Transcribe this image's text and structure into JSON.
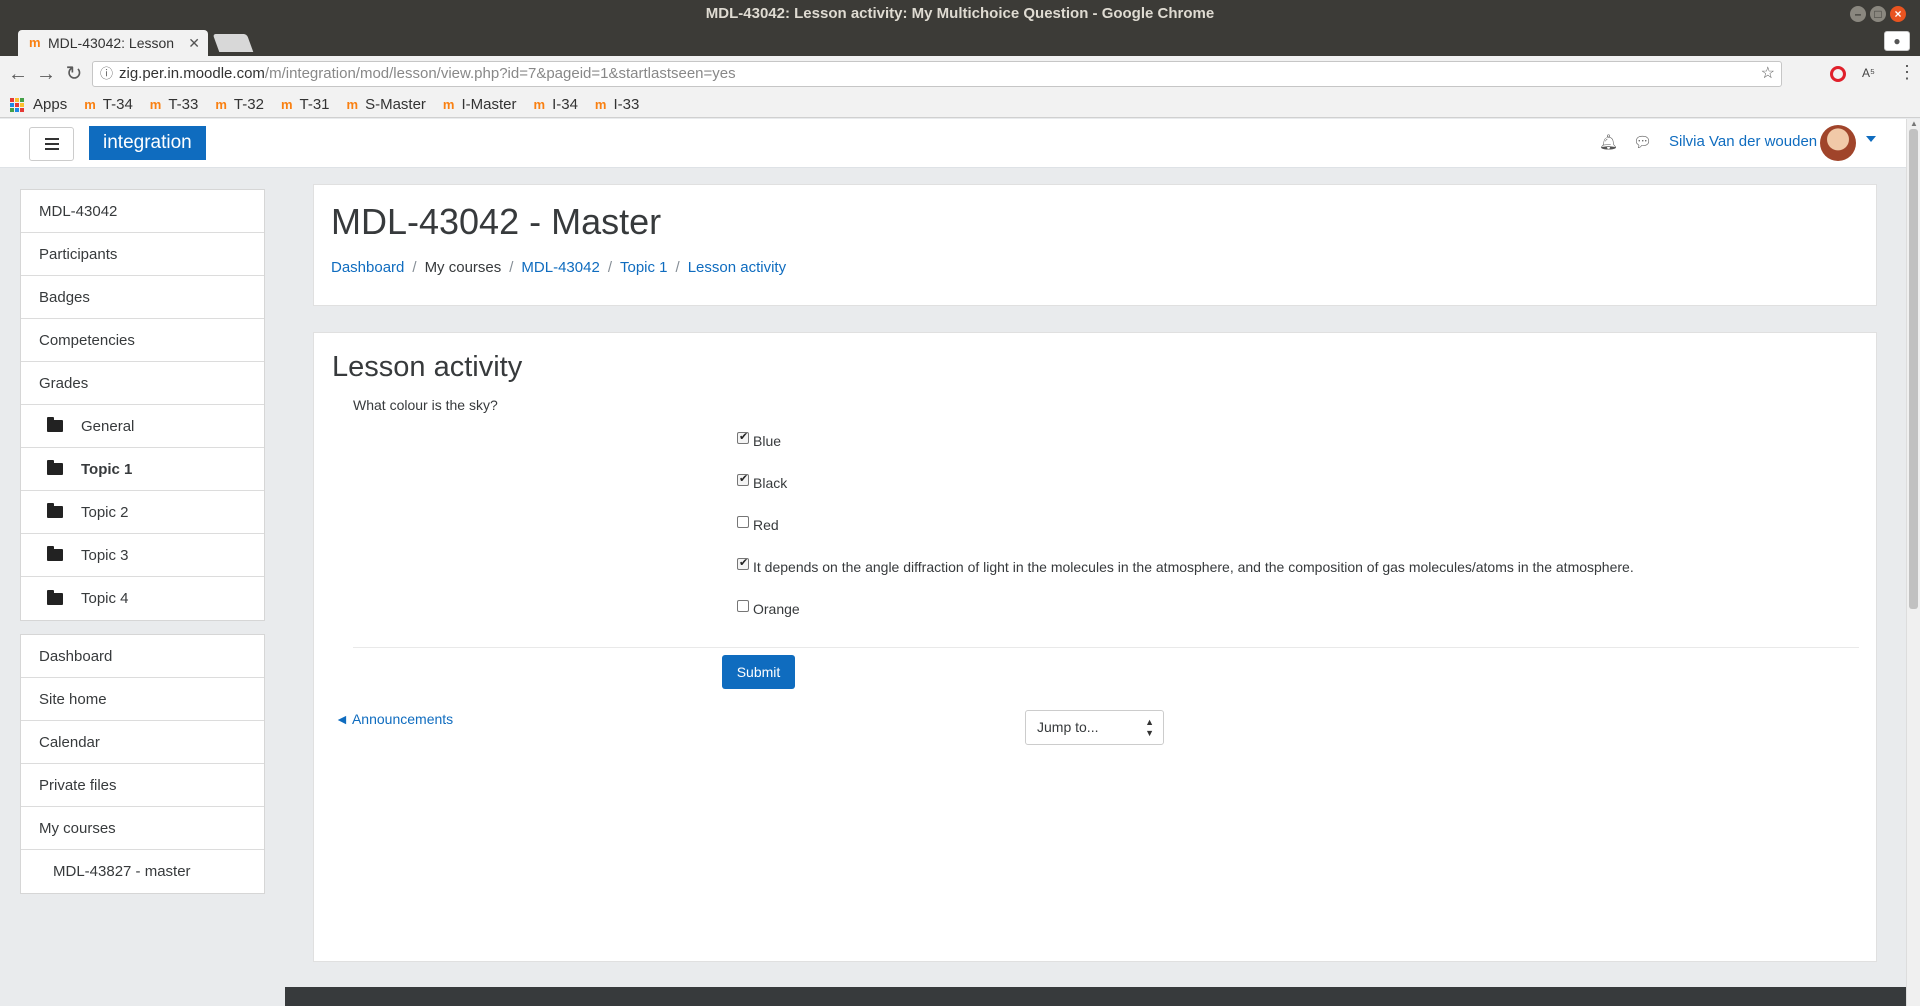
{
  "window": {
    "title": "MDL-43042: Lesson activity: My Multichoice Question - Google Chrome"
  },
  "tab": {
    "label": "MDL-43042: Lesson",
    "favicon": "m"
  },
  "address": {
    "host": "zig.per.in.moodle.com",
    "path": "/m/integration/mod/lesson/view.php?id=7&pageid=1&startlastseen=yes"
  },
  "bookmarks": {
    "apps_label": "Apps",
    "items": [
      "T-34",
      "T-33",
      "T-32",
      "T-31",
      "S-Master",
      "I-Master",
      "I-34",
      "I-33"
    ]
  },
  "navbar": {
    "brand": "integration",
    "user_name": "Silvia Van der wouden"
  },
  "drawer": {
    "course_nav": [
      {
        "label": "MDL-43042"
      },
      {
        "label": "Participants"
      },
      {
        "label": "Badges"
      },
      {
        "label": "Competencies"
      },
      {
        "label": "Grades"
      }
    ],
    "sections": [
      {
        "label": "General"
      },
      {
        "label": "Topic 1"
      },
      {
        "label": "Topic 2"
      },
      {
        "label": "Topic 3"
      },
      {
        "label": "Topic 4"
      }
    ],
    "site_nav": [
      {
        "label": "Dashboard"
      },
      {
        "label": "Site home"
      },
      {
        "label": "Calendar"
      },
      {
        "label": "Private files"
      },
      {
        "label": "My courses"
      },
      {
        "label": "MDL-43827 - master"
      }
    ]
  },
  "header": {
    "title": "MDL-43042 - Master",
    "breadcrumb": [
      "Dashboard",
      "My courses",
      "MDL-43042",
      "Topic 1",
      "Lesson activity"
    ]
  },
  "lesson": {
    "title": "Lesson activity",
    "question": "What colour is the sky?",
    "options": [
      {
        "label": "Blue",
        "checked": true
      },
      {
        "label": "Black",
        "checked": true
      },
      {
        "label": "Red",
        "checked": false
      },
      {
        "label": "It depends on the angle diffraction of light in the molecules in the atmosphere, and the composition of gas molecules/atoms in the atmosphere.",
        "checked": true
      },
      {
        "label": "Orange",
        "checked": false
      }
    ],
    "submit_label": "Submit",
    "prev_link": "◄ Announcements",
    "jump_label": "Jump to..."
  },
  "colors": {
    "brand": "#0f6cbf",
    "moodle_orange": "#f98012"
  }
}
